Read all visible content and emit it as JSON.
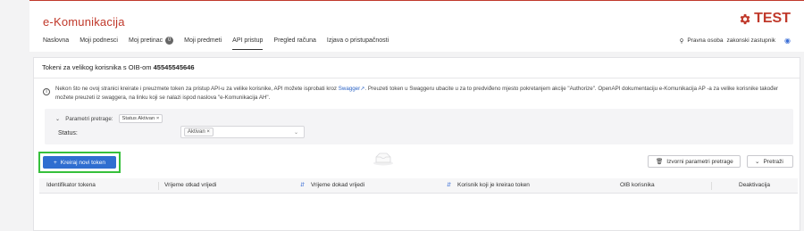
{
  "app": {
    "title": "e-Komunikacija",
    "env_badge": "TEST"
  },
  "nav": {
    "items": [
      {
        "label": "Naslovna"
      },
      {
        "label": "Moji podnesci"
      },
      {
        "label": "Moj pretinac",
        "badge": "0"
      },
      {
        "label": "Moji predmeti"
      },
      {
        "label": "API pristup",
        "active": true
      },
      {
        "label": "Pregled računa"
      },
      {
        "label": "Izjava o pristupačnosti"
      }
    ]
  },
  "user": {
    "role": "Pravna osoba",
    "name": "zakonski zastupnik"
  },
  "page": {
    "title_prefix": "Tokeni za velikog korisnika s OIB-om",
    "oib": "45545545646"
  },
  "info": {
    "text_before_link": "Nekon što ne ovoj stranici kreirate i preuzmete token za pristup API-u za velike korisnike, API možete isprobati kroz",
    "link": "Swagger",
    "text_after_link": ". Preuzeti token u Swaggeru ubacite u za to predviđeno mjesto pokretanjem akcije \"Authorize\". OpenAPI dokumentaciju e-Komunikacija AP -a za velike korisnike također možete preuzeti iz swaggera, na linku koji se nalazi ispod naslova \"e-Komunikacija AH\"."
  },
  "filter": {
    "header_label": "Parametri pretrage:",
    "chip": "Status Aktivan ×",
    "status_label": "Status:",
    "status_value": "Aktivan ×"
  },
  "actions": {
    "create": "Kreiraj novi token",
    "reset": "Izvorni parametri pretrage",
    "search": "Pretraži"
  },
  "table": {
    "columns": [
      "Identifikator tokena",
      "Vrijeme otkad vrijedi",
      "Vrijeme dokad vrijedi",
      "Korisnik koji je kreirao token",
      "OIB korisnika",
      "Deaktivacija"
    ]
  },
  "colors": {
    "brand": "#c0392b",
    "primary": "#2f6ed0",
    "highlight": "#36c03b"
  },
  "icons": [
    "gear-icon",
    "user-icon",
    "globe-icon",
    "info-icon",
    "plus-icon",
    "trash-icon",
    "search-icon",
    "chevron-down-icon",
    "sort-icon",
    "empty-box-icon"
  ]
}
